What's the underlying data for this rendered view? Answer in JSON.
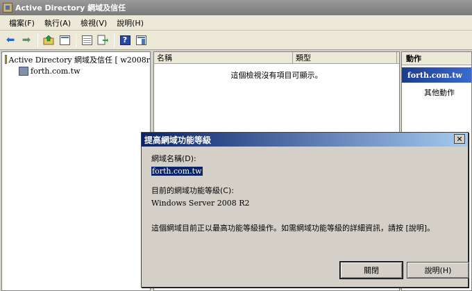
{
  "window": {
    "title": "Active Directory 網域及信任"
  },
  "menu": [
    "檔案(F)",
    "執行(A)",
    "檢視(V)",
    "說明(H)"
  ],
  "toolbar": {
    "icons": [
      "back-arrow-icon",
      "forward-arrow-icon",
      "up-folder-icon",
      "show-hide-tree-icon",
      "properties-icon",
      "export-list-icon",
      "help-icon",
      "show-hide-action-pane-icon"
    ]
  },
  "tree": {
    "root_label": "Active Directory 網域及信任 [ w2008r",
    "domain_label": "forth.com.tw"
  },
  "list": {
    "columns": [
      "名稱",
      "類型"
    ],
    "empty_message": "這個檢視沒有項目可顯示。"
  },
  "actions": {
    "title": "動作",
    "selected": "forth.com.tw",
    "more": "其他動作"
  },
  "dialog": {
    "title": "提高網域功能等級",
    "close_glyph": "✕",
    "domain_name_label": "網域名稱(D):",
    "domain_name_value": "forth.com.tw",
    "current_level_label": "目前的網域功能等級(C):",
    "current_level_value": "Windows Server 2008 R2",
    "info_text": "這個網域目前正以最高功能等級操作。如需網域功能等級的詳細資訊，請按 [說明]。",
    "close_button": "關閉",
    "help_button": "說明(H)"
  }
}
